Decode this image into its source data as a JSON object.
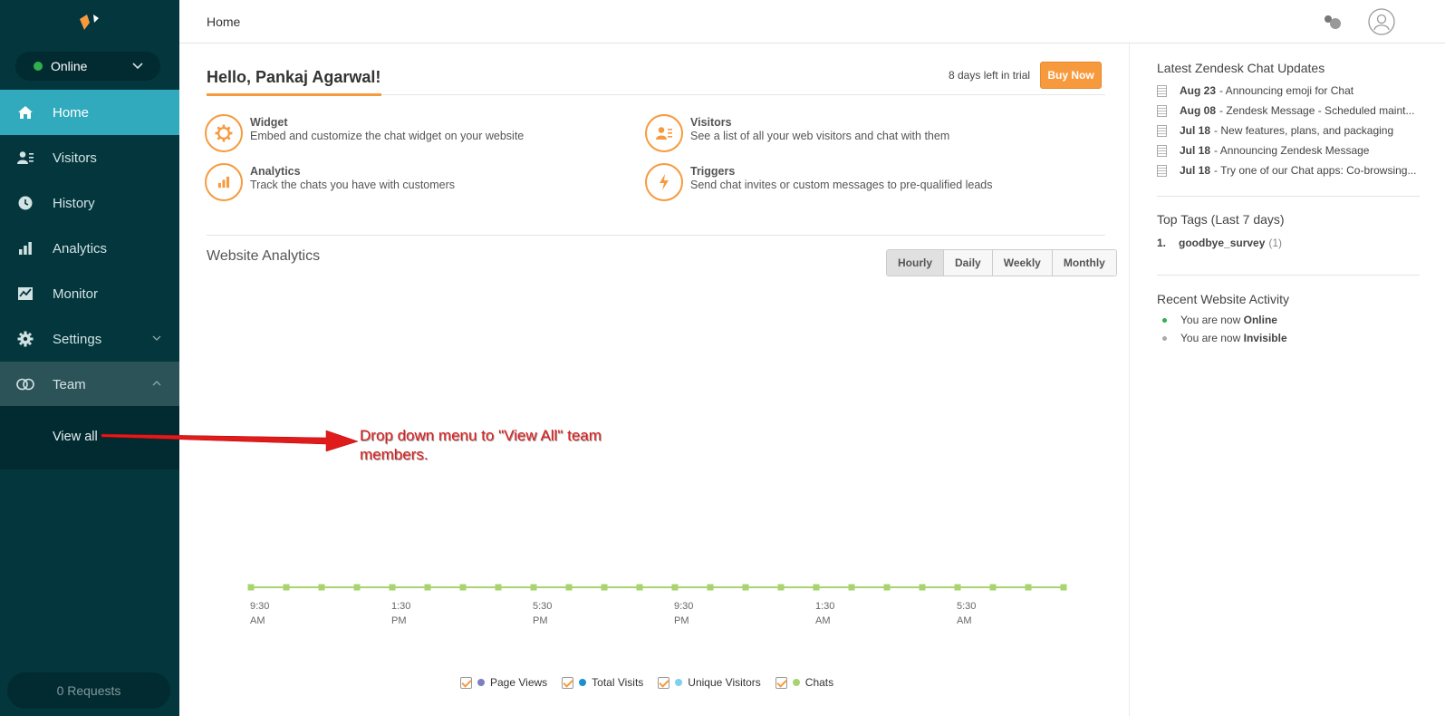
{
  "sidebar": {
    "status": "Online",
    "items": [
      {
        "label": "Home",
        "icon": "home-icon"
      },
      {
        "label": "Visitors",
        "icon": "visitors-icon"
      },
      {
        "label": "History",
        "icon": "clock-icon"
      },
      {
        "label": "Analytics",
        "icon": "bar-chart-icon"
      },
      {
        "label": "Monitor",
        "icon": "monitor-icon"
      },
      {
        "label": "Settings",
        "icon": "gear-icon"
      },
      {
        "label": "Team",
        "icon": "team-icon"
      }
    ],
    "subitem": "View all",
    "requests": "0 Requests"
  },
  "topbar": {
    "title": "Home"
  },
  "main": {
    "greeting": "Hello, Pankaj Agarwal!",
    "trial": "8 days left in trial",
    "buy_now": "Buy Now",
    "features": [
      {
        "title": "Widget",
        "desc": "Embed and customize the chat widget on your website",
        "icon": "gear-icon"
      },
      {
        "title": "Visitors",
        "desc": "See a list of all your web visitors and chat with them",
        "icon": "visitors-icon"
      },
      {
        "title": "Analytics",
        "desc": "Track the chats you have with customers",
        "icon": "bar-chart-icon"
      },
      {
        "title": "Triggers",
        "desc": "Send chat invites or custom messages to pre-qualified leads",
        "icon": "lightning-icon"
      }
    ],
    "analytics_title": "Website Analytics",
    "periods": [
      "Hourly",
      "Daily",
      "Weekly",
      "Monthly"
    ],
    "selected_period": "Hourly",
    "legend": [
      {
        "name": "Page Views",
        "color": "#7b7fc4"
      },
      {
        "name": "Total Visits",
        "color": "#1b8fd0"
      },
      {
        "name": "Unique Visitors",
        "color": "#7fd0ec"
      },
      {
        "name": "Chats",
        "color": "#a8d46f"
      }
    ],
    "annotation": "Drop down menu to \"View All\" team members."
  },
  "chart_data": {
    "type": "line",
    "x_ticks": [
      {
        "time": "9:30",
        "ampm": "AM"
      },
      {
        "time": "1:30",
        "ampm": "PM"
      },
      {
        "time": "5:30",
        "ampm": "PM"
      },
      {
        "time": "9:30",
        "ampm": "PM"
      },
      {
        "time": "1:30",
        "ampm": "AM"
      },
      {
        "time": "5:30",
        "ampm": "AM"
      }
    ],
    "series": [
      {
        "name": "Chats",
        "color": "#a8d46f",
        "values": [
          0,
          0,
          0,
          0,
          0,
          0,
          0,
          0,
          0,
          0,
          0,
          0,
          0,
          0,
          0,
          0,
          0,
          0,
          0,
          0,
          0,
          0,
          0,
          0
        ]
      }
    ]
  },
  "right": {
    "updates_title": "Latest Zendesk Chat Updates",
    "updates": [
      {
        "date": "Aug 23",
        "text": "- Announcing emoji for Chat"
      },
      {
        "date": "Aug 08",
        "text": "- Zendesk Message - Scheduled maint..."
      },
      {
        "date": "Jul 18",
        "text": "- New features, plans, and packaging"
      },
      {
        "date": "Jul 18",
        "text": "- Announcing Zendesk Message"
      },
      {
        "date": "Jul 18",
        "text": "- Try one of our Chat apps: Co-browsing..."
      }
    ],
    "tags_title": "Top Tags (Last 7 days)",
    "tags": [
      {
        "rank": "1.",
        "name": "goodbye_survey",
        "count": "(1)"
      }
    ],
    "activity_title": "Recent Website Activity",
    "activity": [
      {
        "prefix": "You are now",
        "state": "Online",
        "color": "#30b04c"
      },
      {
        "prefix": "You are now",
        "state": "Invisible",
        "color": "#aaaaaa"
      }
    ]
  }
}
